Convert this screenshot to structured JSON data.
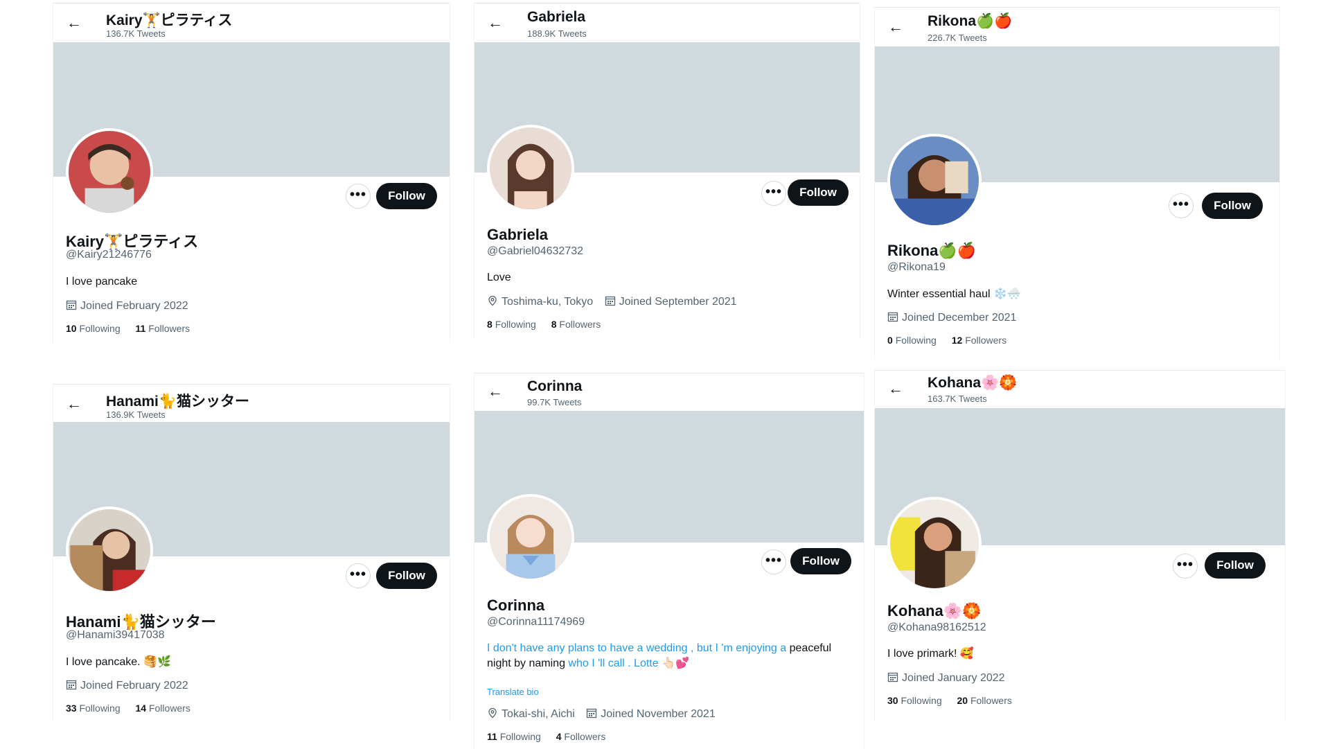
{
  "follow_label": "Follow",
  "more_label": "•••",
  "back_arrow": "←",
  "profiles": [
    {
      "header_name": "Kairy🏋ピラティス",
      "tweets": "136.7K Tweets",
      "name": "Kairy🏋ピラティス",
      "handle": "@Kairy21246776",
      "bio": "I love pancake",
      "joined": "Joined February 2022",
      "following_count": "10",
      "following_label": "Following",
      "followers_count": "11",
      "followers_label": "Followers",
      "avatar_icon": "avatar-photo"
    },
    {
      "header_name": "Gabriela",
      "tweets": "188.9K Tweets",
      "name": "Gabriela",
      "handle": "@Gabriel04632732",
      "bio": "Love",
      "location": "Toshima-ku, Tokyo",
      "joined": "Joined September 2021",
      "following_count": "8",
      "following_label": "Following",
      "followers_count": "8",
      "followers_label": "Followers",
      "avatar_icon": "avatar-photo"
    },
    {
      "header_name": "Rikona🍏🍎",
      "tweets": "226.7K Tweets",
      "name": "Rikona🍏🍎",
      "handle": "@Rikona19",
      "bio": "Winter essential haul ❄️🌨️",
      "joined": "Joined December 2021",
      "following_count": "0",
      "following_label": "Following",
      "followers_count": "12",
      "followers_label": "Followers",
      "avatar_icon": "avatar-photo"
    },
    {
      "header_name": "Hanami🐈猫シッター",
      "tweets": "136.9K Tweets",
      "name": "Hanami🐈猫シッター",
      "handle": "@Hanami39417038",
      "bio": "I love pancake. 🥞🌿",
      "joined": "Joined February 2022",
      "following_count": "33",
      "following_label": "Following",
      "followers_count": "14",
      "followers_label": "Followers",
      "avatar_icon": "avatar-photo"
    },
    {
      "header_name": "Corinna",
      "tweets": "99.7K Tweets",
      "name": "Corinna",
      "handle": "@Corinna11174969",
      "bio_line1_link": "I don't have any plans to have a wedding , but I 'm enjoying a",
      "bio_line1_plain": " peaceful",
      "bio_line2_plain": "night by naming ",
      "bio_line2_link": "who I 'll call . Lotte",
      "bio_line2_emoji": "👆🏻💕",
      "translate": "Translate bio",
      "location": "Tokai-shi, Aichi",
      "joined": "Joined November 2021",
      "following_count": "11",
      "following_label": "Following",
      "followers_count": "4",
      "followers_label": "Followers",
      "avatar_icon": "avatar-photo"
    },
    {
      "header_name": "Kohana🌸🏵️",
      "tweets": "163.7K Tweets",
      "name": "Kohana🌸🏵️",
      "handle": "@Kohana98162512",
      "bio": "I love primark! 🥰",
      "joined": "Joined January 2022",
      "following_count": "30",
      "following_label": "Following",
      "followers_count": "20",
      "followers_label": "Followers",
      "avatar_icon": "avatar-photo"
    }
  ]
}
